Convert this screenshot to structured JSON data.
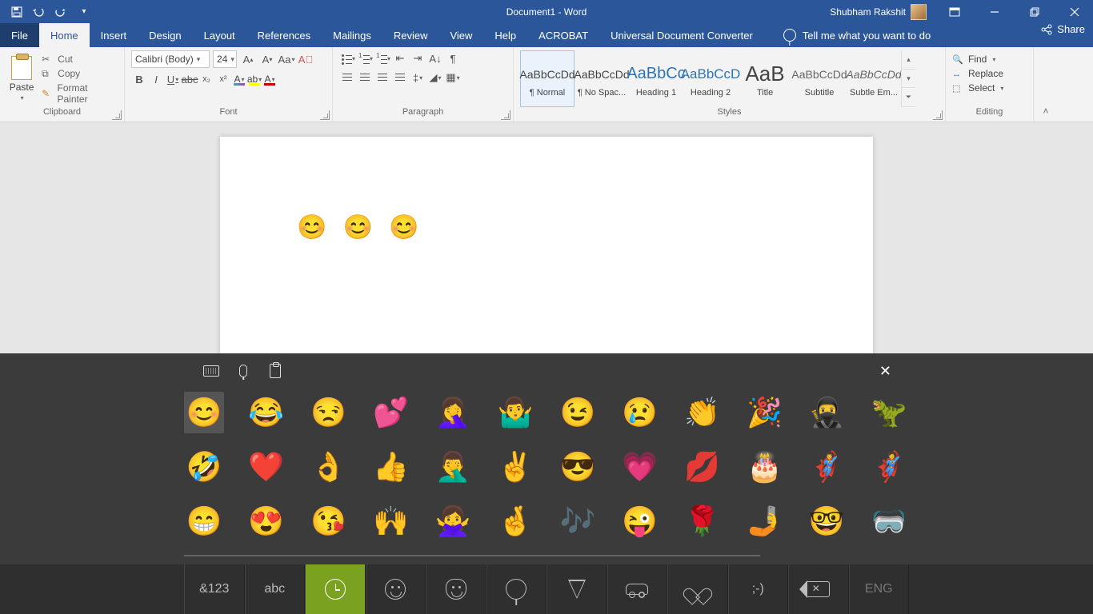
{
  "titlebar": {
    "title": "Document1 - Word",
    "user": "Shubham Rakshit"
  },
  "tabs": {
    "file": "File",
    "home": "Home",
    "insert": "Insert",
    "design": "Design",
    "layout": "Layout",
    "references": "References",
    "mailings": "Mailings",
    "review": "Review",
    "view": "View",
    "help": "Help",
    "acrobat": "ACROBAT",
    "udc": "Universal Document Converter",
    "tellme": "Tell me what you want to do",
    "share": "Share"
  },
  "ribbon": {
    "clipboard": {
      "label": "Clipboard",
      "paste": "Paste",
      "cut": "Cut",
      "copy": "Copy",
      "format_painter": "Format Painter"
    },
    "font": {
      "label": "Font",
      "name": "Calibri (Body)",
      "size": "24"
    },
    "paragraph": {
      "label": "Paragraph"
    },
    "styles": {
      "label": "Styles",
      "items": [
        {
          "name": "¶ Normal",
          "sample": "AaBbCcDd"
        },
        {
          "name": "¶ No Spac...",
          "sample": "AaBbCcDd"
        },
        {
          "name": "Heading 1",
          "sample": "AaBbCc"
        },
        {
          "name": "Heading 2",
          "sample": "AaBbCcD"
        },
        {
          "name": "Title",
          "sample": "AaB"
        },
        {
          "name": "Subtitle",
          "sample": "AaBbCcDd"
        },
        {
          "name": "Subtle Em...",
          "sample": "AaBbCcDd"
        }
      ]
    },
    "editing": {
      "label": "Editing",
      "find": "Find",
      "replace": "Replace",
      "select": "Select"
    }
  },
  "document": {
    "content": "😊 😊 😊"
  },
  "emoji_panel": {
    "grid": [
      [
        "😊",
        "😂",
        "😒",
        "💕",
        "🤦‍♀️",
        "🤷‍♂️",
        "😉",
        "😢",
        "👏",
        "🎉",
        "🥷",
        "🦖"
      ],
      [
        "🤣",
        "❤️",
        "👌",
        "👍",
        "🤦‍♂️",
        "✌️",
        "😎",
        "💗",
        "💋",
        "🎂",
        "🦸‍♂️",
        "🦸"
      ],
      [
        "😁",
        "😍",
        "😘",
        "🙌",
        "🙅‍♀️",
        "🤞",
        "🎶",
        "😜",
        "🌹",
        "🤳",
        "🤓",
        "🥽"
      ]
    ],
    "selected": [
      0,
      0
    ],
    "categories": {
      "symnum": "&123",
      "abc": "abc",
      "winkface": ";-)",
      "lang": "ENG"
    }
  }
}
